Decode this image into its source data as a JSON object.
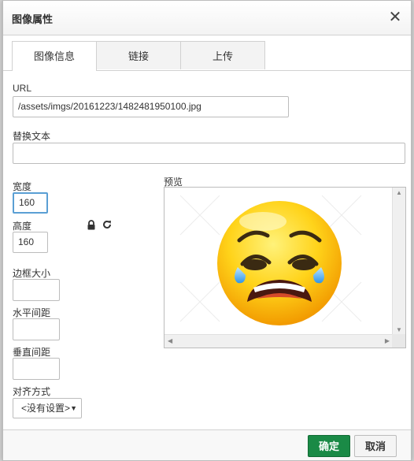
{
  "dialog": {
    "title": "图像属性"
  },
  "tabs": [
    {
      "label": "图像信息",
      "active": true
    },
    {
      "label": "链接",
      "active": false
    },
    {
      "label": "上传",
      "active": false
    }
  ],
  "form": {
    "url_label": "URL",
    "url_value": "/assets/imgs/20161223/1482481950100.jpg",
    "alt_label": "替换文本",
    "alt_value": "",
    "width_label": "宽度",
    "width_value": "160",
    "height_label": "高度",
    "height_value": "160",
    "border_label": "边框大小",
    "border_value": "",
    "hspace_label": "水平间距",
    "hspace_value": "",
    "vspace_label": "垂直间距",
    "vspace_value": "",
    "align_label": "对齐方式",
    "align_value": "<没有设置>"
  },
  "preview": {
    "label": "预览"
  },
  "footer": {
    "ok_label": "确定",
    "cancel_label": "取消"
  },
  "colors": {
    "ok_button": "#1a8a46",
    "focus_border": "#5a9fd4"
  },
  "icons": [
    "close-icon",
    "lock-icon",
    "reset-size-icon",
    "dropdown-arrow-icon"
  ]
}
